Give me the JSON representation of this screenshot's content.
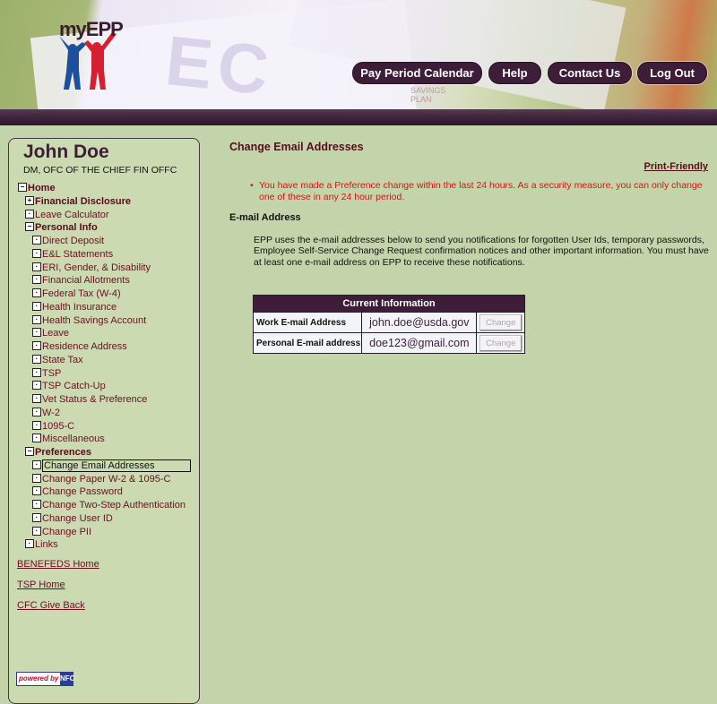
{
  "header": {
    "logo_text": "myEPP",
    "background_text": "EC",
    "savings_line1": "SAVINGS",
    "savings_line2": "PLAN",
    "nav": [
      {
        "label": "Pay Period Calendar"
      },
      {
        "label": "Help"
      },
      {
        "label": "Contact Us"
      },
      {
        "label": "Log Out"
      }
    ]
  },
  "sidebar": {
    "user_name": "John Doe",
    "user_org": "DM, OFC OF THE CHIEF FIN OFFC",
    "tree": [
      {
        "label": "Home",
        "level": 0,
        "state": "expanded",
        "bold": true
      },
      {
        "label": "Financial Disclosure",
        "level": 1,
        "state": "collapsed",
        "bold": true
      },
      {
        "label": "Leave Calculator",
        "level": 1,
        "state": "leaf",
        "bold": false
      },
      {
        "label": "Personal Info",
        "level": 1,
        "state": "expanded",
        "bold": true
      },
      {
        "label": "Direct Deposit",
        "level": 2,
        "state": "leaf"
      },
      {
        "label": "E&L Statements",
        "level": 2,
        "state": "leaf"
      },
      {
        "label": "ERI, Gender, & Disability",
        "level": 2,
        "state": "leaf"
      },
      {
        "label": "Financial Allotments",
        "level": 2,
        "state": "leaf"
      },
      {
        "label": "Federal Tax (W-4)",
        "level": 2,
        "state": "leaf"
      },
      {
        "label": "Health Insurance",
        "level": 2,
        "state": "leaf"
      },
      {
        "label": "Health Savings Account",
        "level": 2,
        "state": "leaf"
      },
      {
        "label": "Leave",
        "level": 2,
        "state": "leaf"
      },
      {
        "label": "Residence Address",
        "level": 2,
        "state": "leaf"
      },
      {
        "label": "State Tax",
        "level": 2,
        "state": "leaf"
      },
      {
        "label": "TSP",
        "level": 2,
        "state": "leaf"
      },
      {
        "label": "TSP Catch-Up",
        "level": 2,
        "state": "leaf"
      },
      {
        "label": "Vet Status & Preference",
        "level": 2,
        "state": "leaf"
      },
      {
        "label": "W-2",
        "level": 2,
        "state": "leaf"
      },
      {
        "label": "1095-C",
        "level": 2,
        "state": "leaf"
      },
      {
        "label": "Miscellaneous",
        "level": 2,
        "state": "leaf"
      },
      {
        "label": "Preferences",
        "level": 1,
        "state": "expanded",
        "bold": true
      },
      {
        "label": "Change Email Addresses",
        "level": 2,
        "state": "leaf",
        "selected": true
      },
      {
        "label": "Change Paper W-2 & 1095-C",
        "level": 2,
        "state": "leaf"
      },
      {
        "label": "Change Password",
        "level": 2,
        "state": "leaf"
      },
      {
        "label": "Change Two-Step Authentication",
        "level": 2,
        "state": "leaf"
      },
      {
        "label": "Change User ID",
        "level": 2,
        "state": "leaf"
      },
      {
        "label": "Change PII",
        "level": 2,
        "state": "leaf"
      },
      {
        "label": "Links",
        "level": 1,
        "state": "leaf"
      }
    ],
    "links": [
      {
        "label": "BENEFEDS Home"
      },
      {
        "label": "TSP Home"
      },
      {
        "label": "CFC Give Back"
      }
    ],
    "powered_by": "powered by",
    "powered_logo": "NFC"
  },
  "main": {
    "title": "Change Email Addresses",
    "print_friendly": "Print-Friendly",
    "alert_bullet": "•",
    "alert": "You have made a Preference change within the last 24 hours. As a security measure, you can only change one of these in any 24 hour period.",
    "section_heading": "E-mail Address",
    "intro": "EPP uses the e-mail addresses below to send you notifications for forgotten User Ids, temporary passwords, Employee Self-Service Change Request confirmation notices and other important information. You must have at least one e-mail address on EPP to receive these notifications.",
    "table": {
      "header": "Current Information",
      "rows": [
        {
          "label": "Work E-mail Address",
          "value": "john.doe@usda.gov",
          "button": "Change"
        },
        {
          "label": "Personal E-mail address",
          "value": "doe123@gmail.com",
          "button": "Change"
        }
      ]
    }
  },
  "colors": {
    "brand_purple": "#3d1d38",
    "link_maroon": "#6b1023",
    "alert_red": "#e01010",
    "page_green": "#c7d6ae"
  }
}
